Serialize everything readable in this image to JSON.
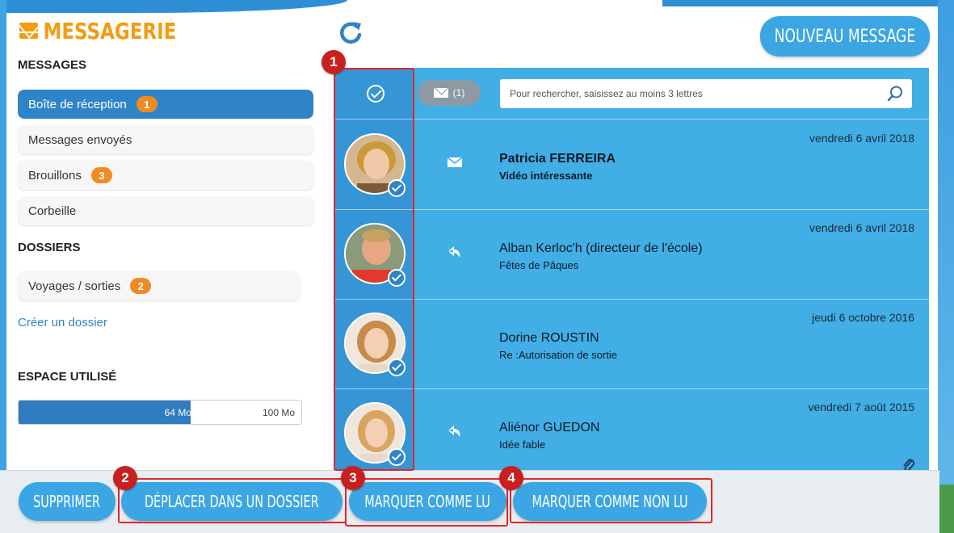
{
  "app": {
    "title": "MESSAGERIE"
  },
  "sidebar": {
    "messages_heading": "MESSAGES",
    "items": [
      {
        "label": "Boîte de réception",
        "badge": "1",
        "active": true
      },
      {
        "label": "Messages envoyés",
        "badge": null,
        "active": false
      },
      {
        "label": "Brouillons",
        "badge": "3",
        "active": false
      },
      {
        "label": "Corbeille",
        "badge": null,
        "active": false
      }
    ],
    "folders_heading": "DOSSIERS",
    "folders": [
      {
        "label": "Voyages / sorties",
        "badge": "2"
      }
    ],
    "create_folder_label": "Créer un dossier",
    "storage": {
      "heading": "ESPACE UTILISÉ",
      "used_label": "64 Mo",
      "total_label": "100 Mo",
      "used_fraction": 0.64
    }
  },
  "toolbar": {
    "new_message_label": "NOUVEAU MESSAGE",
    "unread_filter_label": "(1)",
    "search_placeholder": "Pour rechercher, saisissez au moins 3 lettres"
  },
  "messages": [
    {
      "date": "vendredi 6 avril 2018",
      "sender": "Patricia FERREIRA",
      "subject": "Vidéo intéressante",
      "status_icon": "envelope-icon",
      "unread": true,
      "attachment": false
    },
    {
      "date": "vendredi 6 avril 2018",
      "sender": "Alban Kerloc'h (directeur de l'école)",
      "subject": "Fêtes de Pâques",
      "status_icon": "reply-icon",
      "unread": false,
      "attachment": false
    },
    {
      "date": "jeudi 6 octobre 2016",
      "sender": "Dorine ROUSTIN",
      "subject": "Re :Autorisation de sortie",
      "status_icon": "none",
      "unread": false,
      "attachment": false
    },
    {
      "date": "vendredi 7 août 2015",
      "sender": "Aliénor GUEDON",
      "subject": "Idée fable",
      "status_icon": "reply-icon",
      "unread": false,
      "attachment": true
    }
  ],
  "actions": {
    "delete_label": "SUPPRIMER",
    "move_label": "DÉPLACER DANS UN DOSSIER",
    "mark_read_label": "MARQUER COMME LU",
    "mark_unread_label": "MARQUER COMME NON LU"
  },
  "annotations": [
    "1",
    "2",
    "3",
    "4"
  ],
  "colors": {
    "brand_orange": "#f39c12",
    "badge_orange": "#f08a22",
    "primary_blue": "#2f84c8",
    "panel_blue": "#42aee6",
    "annotation_red": "#e0262b"
  }
}
